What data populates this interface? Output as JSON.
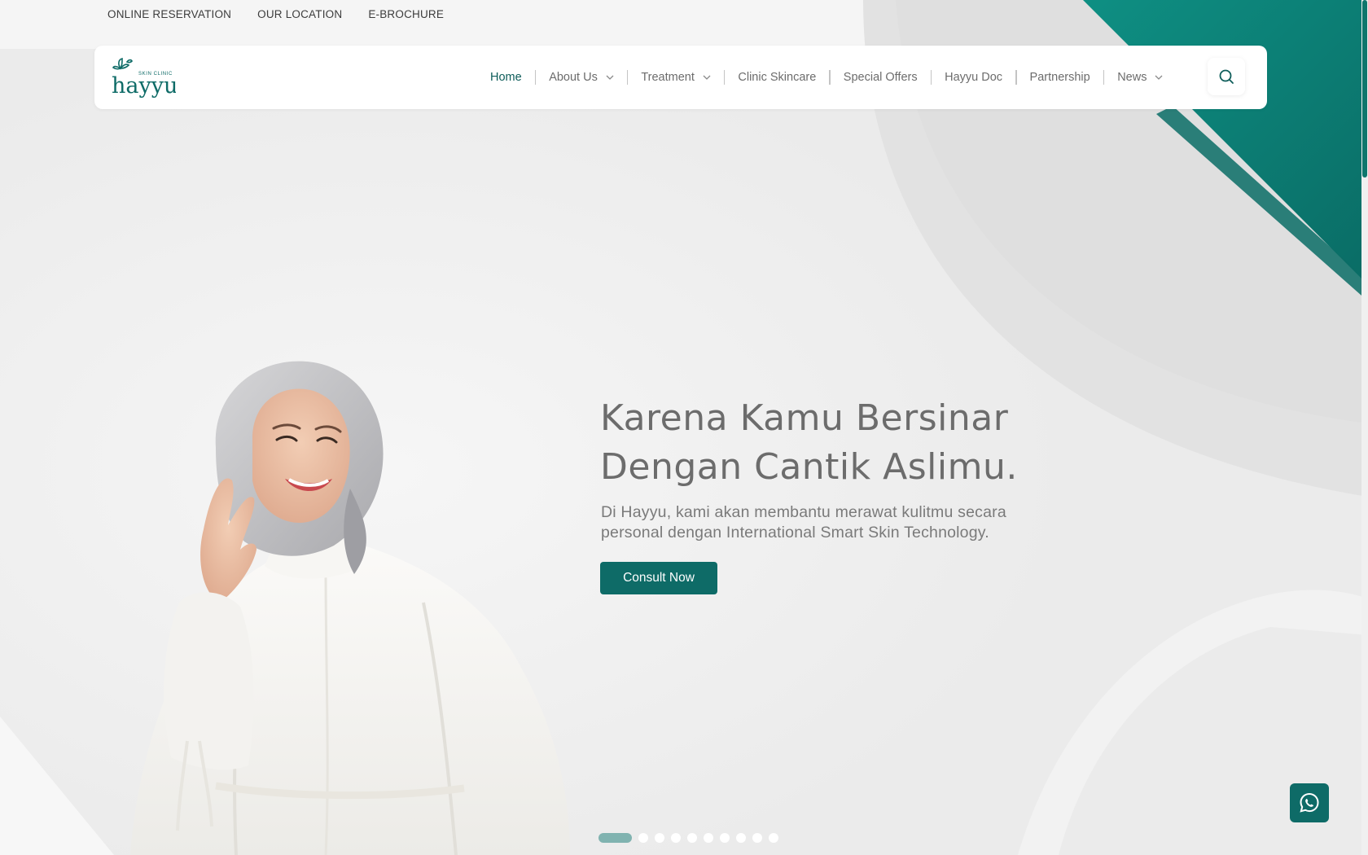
{
  "top_links": [
    {
      "label": "ONLINE RESERVATION",
      "active": true
    },
    {
      "label": "OUR LOCATION",
      "active": false
    },
    {
      "label": "E-BROCHURE",
      "active": false
    }
  ],
  "logo": {
    "brand": "hayyu",
    "tagline": "SKIN CLINIC"
  },
  "nav": {
    "items": [
      {
        "label": "Home",
        "active": true,
        "dropdown": false
      },
      {
        "label": "About Us",
        "active": false,
        "dropdown": true
      },
      {
        "label": "Treatment",
        "active": false,
        "dropdown": true
      },
      {
        "label": "Clinic Skincare",
        "active": false,
        "dropdown": false
      },
      {
        "label": "Special Offers",
        "active": false,
        "dropdown": false
      },
      {
        "label": "Hayyu Doc",
        "active": false,
        "dropdown": false
      },
      {
        "label": "Partnership",
        "active": false,
        "dropdown": false
      },
      {
        "label": "News",
        "active": false,
        "dropdown": true
      }
    ],
    "search_icon": "search-icon"
  },
  "hero": {
    "title_line1": "Karena Kamu Bersinar",
    "title_line2": "Dengan Cantik Aslimu.",
    "subtitle_line1": "Di Hayyu, kami akan membantu merawat kulitmu secara",
    "subtitle_line2": "personal dengan International Smart Skin Technology.",
    "cta_label": "Consult Now",
    "slide_count": 10,
    "active_slide": 1
  },
  "floating": {
    "whatsapp_icon": "whatsapp-icon"
  },
  "colors": {
    "brand": "#0e6b67",
    "accent_teal": "#0f8a7e",
    "nav_text": "#6c6c6c",
    "hero_text": "#6c6c6c",
    "dot_active": "#80b3b0"
  }
}
